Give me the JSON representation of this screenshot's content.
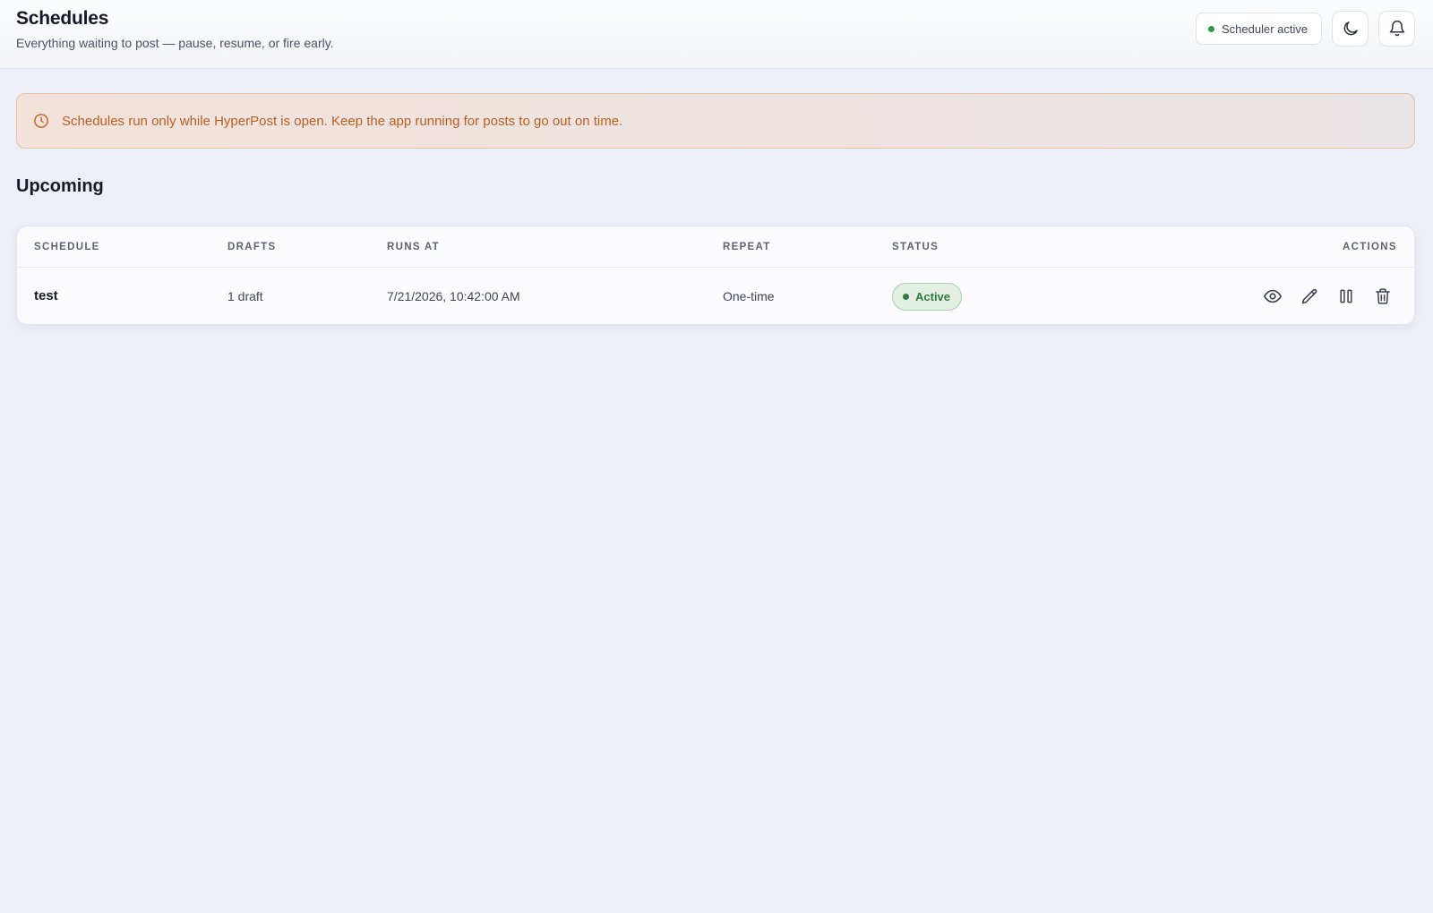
{
  "header": {
    "title": "Schedules",
    "subtitle": "Everything waiting to post — pause, resume, or fire early.",
    "scheduler_status": "Scheduler active",
    "status_color": "#2f9a45"
  },
  "banner": {
    "icon": "clock-icon",
    "text": "Schedules run only while HyperPost is open. Keep the app running for posts to go out on time.",
    "color": "#b85f24"
  },
  "section": {
    "title": "Upcoming"
  },
  "table": {
    "columns": [
      "SCHEDULE",
      "DRAFTS",
      "RUNS AT",
      "REPEAT",
      "STATUS",
      "ACTIONS"
    ],
    "rows": [
      {
        "schedule": "test",
        "drafts": "1 draft",
        "runs_at": "7/21/2026, 10:42:00 AM",
        "repeat": "One-time",
        "status": "Active",
        "actions": [
          "eye-icon",
          "pencil-icon",
          "pause-icon",
          "trash-icon"
        ]
      }
    ]
  },
  "icons": {
    "theme_toggle": "moon-icon",
    "notifications": "bell-icon"
  }
}
